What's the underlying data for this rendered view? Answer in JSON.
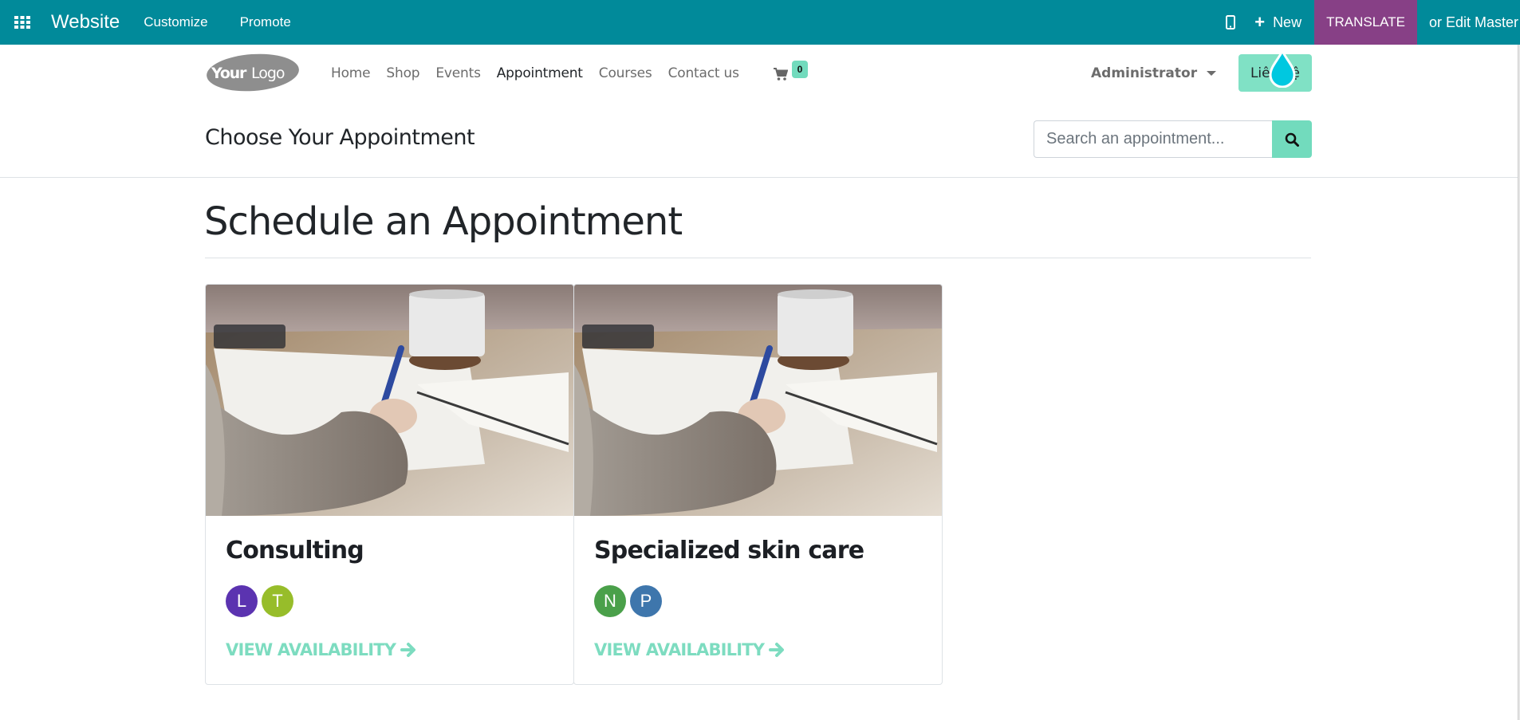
{
  "topbar": {
    "brand": "Website",
    "menu": [
      "Customize",
      "Promote"
    ],
    "new_label": "New",
    "translate_label": "TRANSLATE",
    "edit_master_label": "or Edit Master",
    "bg_color": "#018a9a",
    "translate_color": "#874086"
  },
  "header": {
    "logo_text": "YourLogo",
    "nav": [
      {
        "label": "Home",
        "active": false
      },
      {
        "label": "Shop",
        "active": false
      },
      {
        "label": "Events",
        "active": false
      },
      {
        "label": "Appointment",
        "active": true
      },
      {
        "label": "Courses",
        "active": false
      },
      {
        "label": "Contact us",
        "active": false
      }
    ],
    "cart_count": "0",
    "user_label": "Administrator",
    "contact_button": "Liên hệ",
    "accent_color": "#72dbbd"
  },
  "subheader": {
    "title": "Choose Your Appointment",
    "search_placeholder": "Search an appointment..."
  },
  "main": {
    "title": "Schedule an Appointment",
    "cards": [
      {
        "name": "Consulting",
        "avatars": [
          {
            "initial": "L",
            "color": "#5b33b0"
          },
          {
            "initial": "T",
            "color": "#97bd2a"
          }
        ],
        "link": "VIEW AVAILABILITY"
      },
      {
        "name": "Specialized skin care",
        "avatars": [
          {
            "initial": "N",
            "color": "#4aa04a"
          },
          {
            "initial": "P",
            "color": "#3e76ac"
          }
        ],
        "link": "VIEW AVAILABILITY"
      }
    ]
  }
}
